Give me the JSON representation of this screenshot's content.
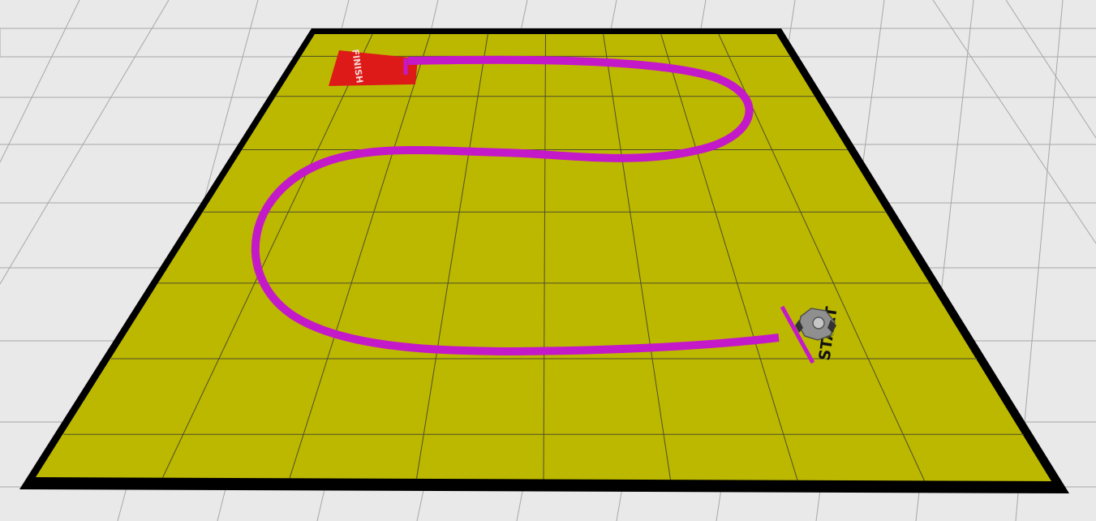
{
  "scene": {
    "finish_label": "FINISH",
    "start_label": "START",
    "colors": {
      "background": "#e9e9e9",
      "background_grid": "#a7a7a7",
      "board_fill": "#bcb800",
      "board_border": "#000000",
      "board_grid": "#4e4e2a",
      "track": "#c419c8",
      "finish_flag": "#dd1a17",
      "finish_text": "#f7d6d6",
      "start_text": "#111111",
      "robot_body": "#8f8f8f"
    },
    "icons": {
      "finish_flag": "finish-flag-icon",
      "robot": "robot-car-icon"
    }
  }
}
